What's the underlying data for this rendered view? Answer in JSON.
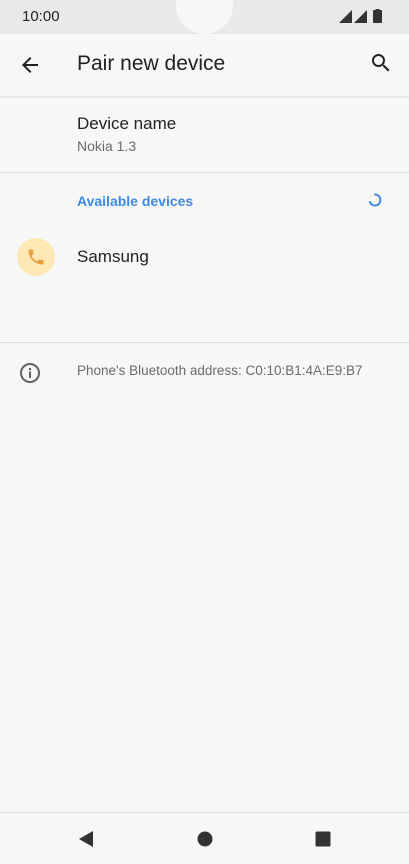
{
  "status_bar": {
    "time": "10:00",
    "icons": [
      "signal-icon",
      "signal-icon",
      "battery-icon"
    ]
  },
  "app_bar": {
    "title": "Pair new device",
    "back_icon": "arrow-back-icon",
    "search_icon": "search-icon"
  },
  "device_name": {
    "title": "Device name",
    "value": "Nokia 1.3"
  },
  "available_devices": {
    "header": "Available devices",
    "scanning_icon": "spinner-icon",
    "accent_color": "#3f8ae0",
    "items": [
      {
        "label": "Samsung",
        "icon": "phone-icon",
        "icon_bg": "#fde8b6",
        "icon_color": "#e8a13a"
      }
    ]
  },
  "footer_info": {
    "icon": "info-icon",
    "text": "Phone's Bluetooth address: C0:10:B1:4A:E9:B7"
  },
  "nav_bar": {
    "buttons": [
      "back-triangle-icon",
      "home-circle-icon",
      "recents-square-icon"
    ]
  }
}
